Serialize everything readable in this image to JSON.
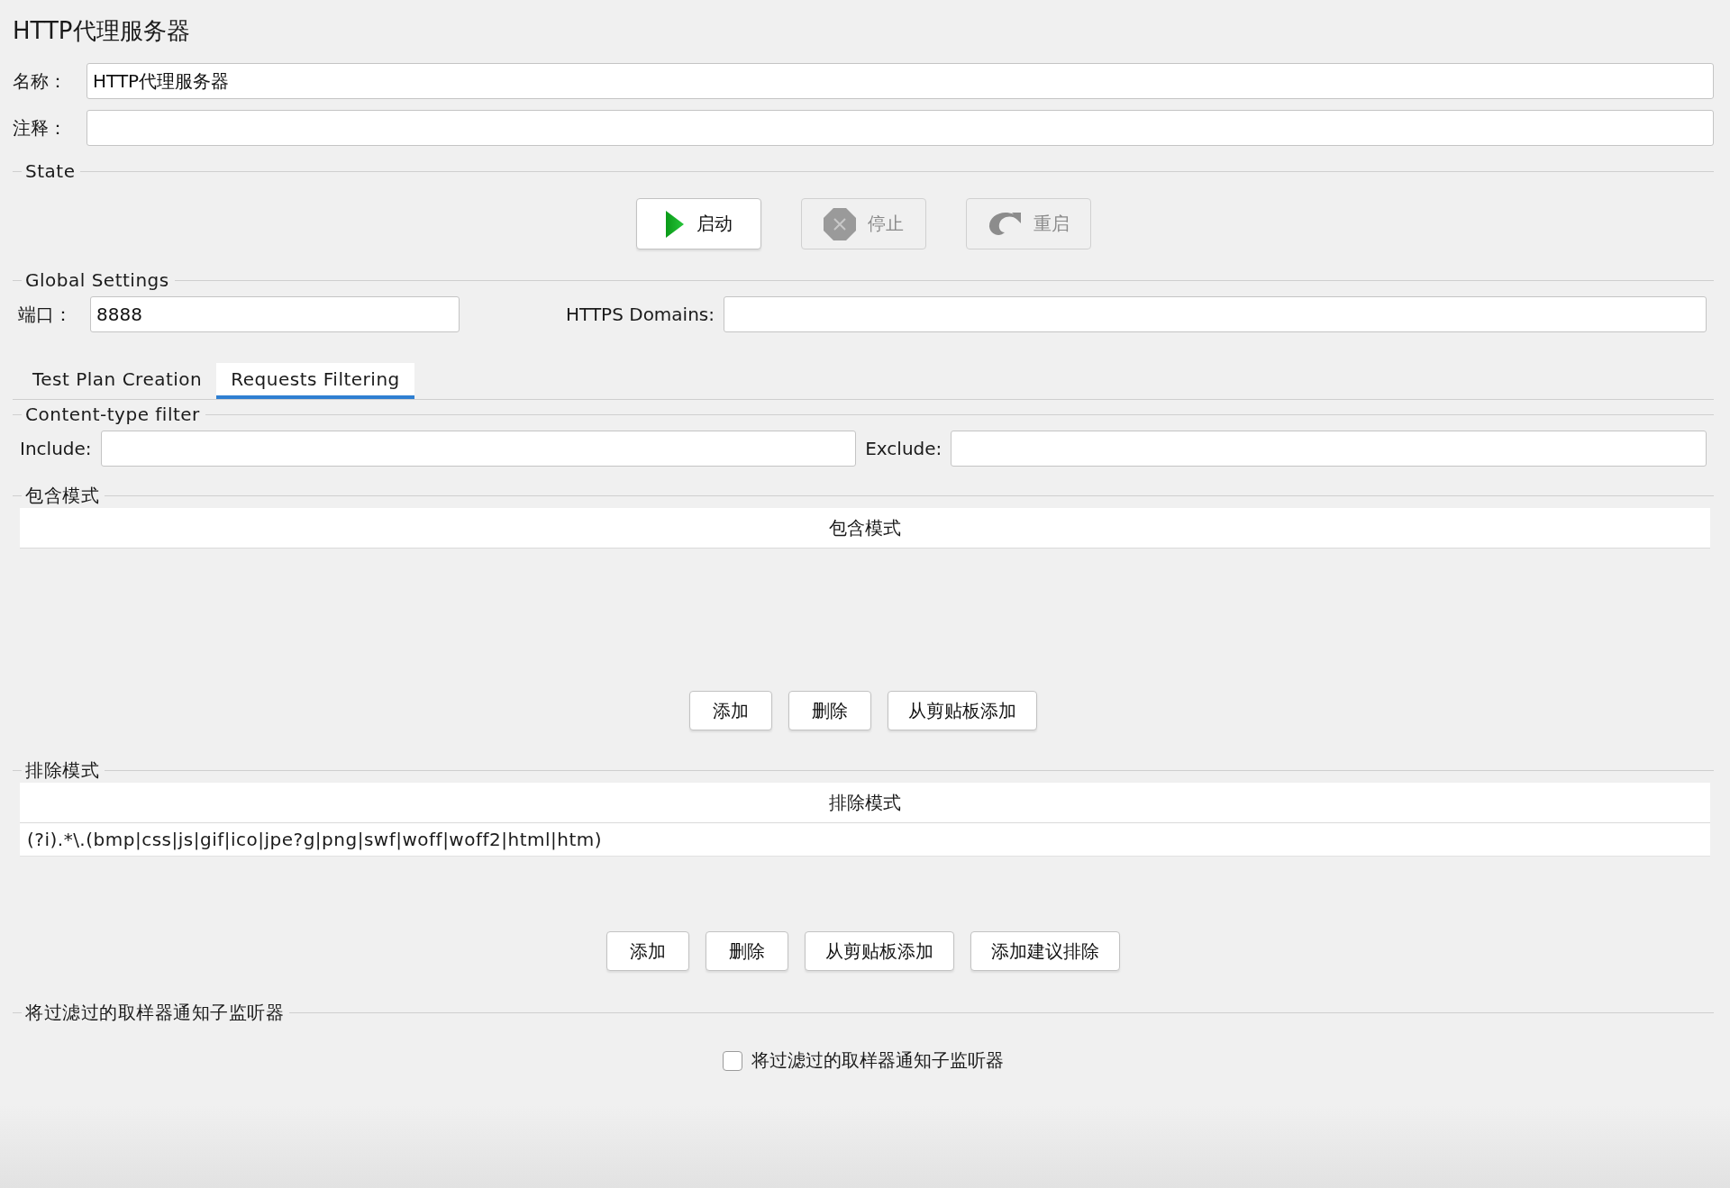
{
  "title": "HTTP代理服务器",
  "fields": [
    {
      "label": "名称：",
      "value": "HTTP代理服务器"
    },
    {
      "label": "注释："
    }
  ],
  "state": {
    "legend": "State",
    "buttons": [
      {
        "kind": "start",
        "label": "启动",
        "disabled": false
      },
      {
        "kind": "stop",
        "label": "停止",
        "disabled": true
      },
      {
        "kind": "restart",
        "label": "重启",
        "disabled": true
      }
    ]
  },
  "global_settings": {
    "legend": "Global Settings",
    "port": {
      "label": "端口：",
      "value": "8888"
    },
    "https_domains": {
      "label": "HTTPS Domains:"
    }
  },
  "tabs": [
    {
      "label": "Test Plan Creation",
      "selected": false
    },
    {
      "label": "Requests Filtering",
      "selected": true
    }
  ],
  "content_type_filter": {
    "legend": "Content-type filter",
    "include": {
      "label": "Include:"
    },
    "exclude": {
      "label": "Exclude:"
    }
  },
  "include_patterns": {
    "legend": "包含模式",
    "column": "包含模式",
    "buttons": [
      "添加",
      "删除",
      "从剪贴板添加"
    ]
  },
  "exclude_patterns": {
    "legend": "排除模式",
    "column": "排除模式",
    "rows": [
      "(?i).*\\.(bmp|css|js|gif|ico|jpe?g|png|swf|woff|woff2|html|htm)"
    ],
    "buttons": [
      "添加",
      "删除",
      "从剪贴板添加",
      "添加建议排除"
    ]
  },
  "notify": {
    "legend": "将过滤过的取样器通知子监听器",
    "checkbox": {
      "label": "将过滤过的取样器通知子监听器",
      "checked": false
    }
  }
}
